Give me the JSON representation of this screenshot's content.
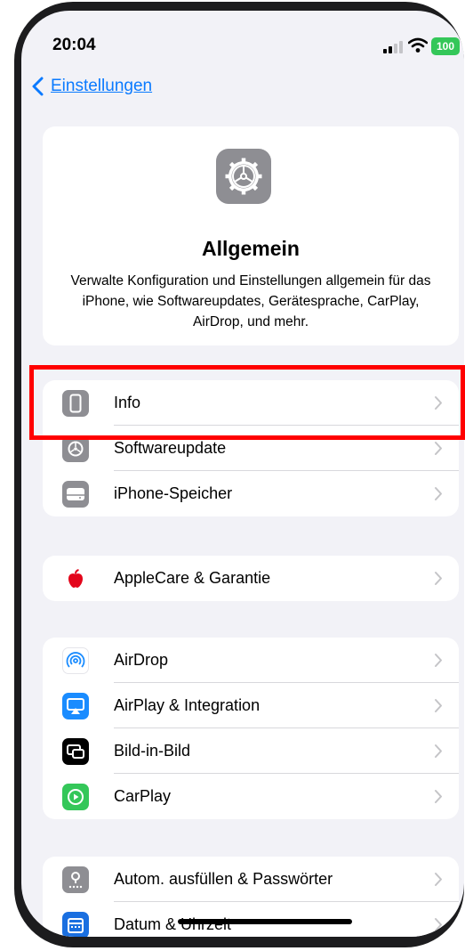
{
  "status_bar": {
    "time": "20:04",
    "battery": "100"
  },
  "nav": {
    "back_label": "Einstellungen"
  },
  "header": {
    "title": "Allgemein",
    "description": "Verwalte Konfiguration und Einstellungen allgemein für das iPhone, wie Softwareupdates, Gerätesprache, CarPlay, AirDrop, und mehr."
  },
  "groups": [
    {
      "items": [
        {
          "label": "Info",
          "icon": "iphone-icon"
        },
        {
          "label": "Softwareupdate",
          "icon": "gear-icon"
        },
        {
          "label": "iPhone-Speicher",
          "icon": "storage-icon"
        }
      ]
    },
    {
      "items": [
        {
          "label": "AppleCare & Garantie",
          "icon": "apple-icon"
        }
      ]
    },
    {
      "items": [
        {
          "label": "AirDrop",
          "icon": "airdrop-icon"
        },
        {
          "label": "AirPlay & Integration",
          "icon": "airplay-icon"
        },
        {
          "label": "Bild-in-Bild",
          "icon": "picture-in-picture-icon"
        },
        {
          "label": "CarPlay",
          "icon": "carplay-icon"
        }
      ]
    },
    {
      "items": [
        {
          "label": "Autom. ausfüllen & Passwörter",
          "icon": "key-icon"
        },
        {
          "label": "Datum & Uhrzeit",
          "icon": "calendar-icon"
        }
      ]
    }
  ],
  "colors": {
    "accent": "#0a7aff",
    "highlight": "#ff0000",
    "icon_gray": "#8e8e93",
    "airplay_blue": "#1a8cff",
    "carplay_green": "#34c759",
    "battery_green": "#34c759"
  }
}
